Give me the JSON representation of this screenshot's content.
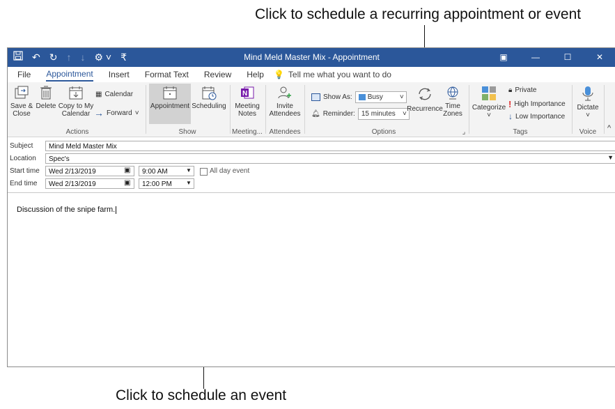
{
  "callouts": {
    "top": "Click to schedule a recurring appointment or event",
    "bottom": "Click to schedule an event"
  },
  "window": {
    "title": "Mind Meld Master Mix  -  Appointment",
    "qat_icons": [
      "save-icon",
      "undo-icon",
      "redo-icon",
      "up-icon",
      "down-icon",
      "categorize-icon",
      "customize-icon"
    ],
    "controls": [
      "ribbon-display-icon",
      "minimize-icon",
      "maximize-icon",
      "close-icon"
    ]
  },
  "tabs": [
    "File",
    "Appointment",
    "Insert",
    "Format Text",
    "Review",
    "Help"
  ],
  "active_tab": "Appointment",
  "tell_me": "Tell me what you want to do",
  "ribbon": {
    "actions": {
      "save_close": [
        "Save &",
        "Close"
      ],
      "delete": "Delete",
      "copy_to_calendar": [
        "Copy to My",
        "Calendar"
      ],
      "calendar": "Calendar",
      "forward": "Forward",
      "label": "Actions"
    },
    "show": {
      "appointment": "Appointment",
      "scheduling": "Scheduling",
      "label": "Show"
    },
    "meeting": {
      "meeting_notes": [
        "Meeting",
        "Notes"
      ],
      "label": "Meeting..."
    },
    "attendees": {
      "invite": [
        "Invite",
        "Attendees"
      ],
      "label": "Attendees"
    },
    "options": {
      "show_as_label": "Show As:",
      "show_as_value": "Busy",
      "reminder_label": "Reminder:",
      "reminder_value": "15 minutes",
      "recurrence": "Recurrence",
      "time_zones": [
        "Time",
        "Zones"
      ],
      "label": "Options"
    },
    "tags": {
      "categorize": "Categorize",
      "private": "Private",
      "high": "High Importance",
      "low": "Low Importance",
      "label": "Tags"
    },
    "voice": {
      "dictate": "Dictate",
      "label": "Voice"
    }
  },
  "form": {
    "subject_label": "Subject",
    "subject_value": "Mind Meld Master Mix",
    "location_label": "Location",
    "location_value": "Spec's",
    "start_label": "Start time",
    "start_date": "Wed 2/13/2019",
    "start_time": "9:00 AM",
    "end_label": "End time",
    "end_date": "Wed 2/13/2019",
    "end_time": "12:00 PM",
    "all_day": "All day event"
  },
  "body_text": "Discussion of the snipe farm.",
  "colors": {
    "title_bar": "#2b579a",
    "busy_swatch": "#4a90d9",
    "high_importance": "#e03131"
  }
}
